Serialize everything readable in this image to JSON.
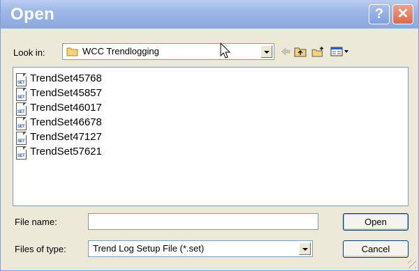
{
  "window": {
    "title": "Open",
    "help_glyph": "?",
    "close_glyph": "✕"
  },
  "look_in": {
    "label": "Look in:",
    "value": "WCC Trendlogging",
    "icon": "folder-icon"
  },
  "toolbar": {
    "icons": [
      "back-arrow-icon",
      "up-folder-icon",
      "new-folder-icon",
      "view-menu-icon"
    ]
  },
  "files": [
    {
      "name": "TrendSet45768",
      "icon_text": "SET"
    },
    {
      "name": "TrendSet45857",
      "icon_text": "SET"
    },
    {
      "name": "TrendSet46017",
      "icon_text": "SET"
    },
    {
      "name": "TrendSet46678",
      "icon_text": "SET"
    },
    {
      "name": "TrendSet47127",
      "icon_text": "SET"
    },
    {
      "name": "TrendSet57621",
      "icon_text": "SET"
    }
  ],
  "file_name": {
    "label": "File name:",
    "value": ""
  },
  "file_type": {
    "label": "Files of type:",
    "value": "Trend Log Setup File (*.set)"
  },
  "buttons": {
    "open": "Open",
    "cancel": "Cancel"
  },
  "colors": {
    "title_bar": "#9db7e6",
    "close_button": "#d9694a",
    "dialog_bg": "#ece9d8",
    "border": "#7f9db9"
  }
}
